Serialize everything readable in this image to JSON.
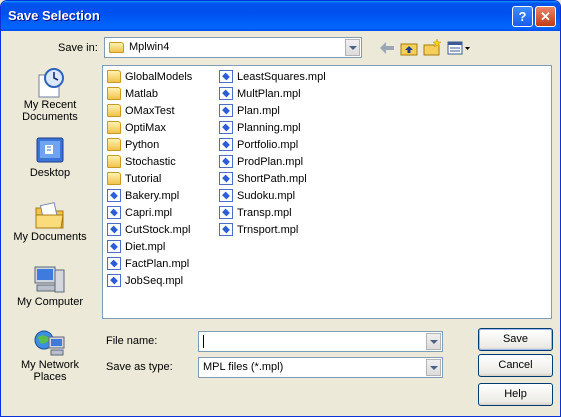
{
  "window": {
    "title": "Save Selection"
  },
  "titlebar": {
    "help": "?",
    "close": "✕"
  },
  "save_in": {
    "label": "Save in:",
    "value": "Mplwin4"
  },
  "places": [
    {
      "label": "My Recent Documents",
      "icon": "clock-documents-icon"
    },
    {
      "label": "Desktop",
      "icon": "desktop-icon"
    },
    {
      "label": "My Documents",
      "icon": "folder-documents-icon"
    },
    {
      "label": "My Computer",
      "icon": "computer-icon"
    },
    {
      "label": "My Network Places",
      "icon": "network-icon"
    }
  ],
  "files_col1": [
    {
      "name": "GlobalModels",
      "type": "folder"
    },
    {
      "name": "Matlab",
      "type": "folder"
    },
    {
      "name": "OMaxTest",
      "type": "folder"
    },
    {
      "name": "OptiMax",
      "type": "folder"
    },
    {
      "name": "Python",
      "type": "folder"
    },
    {
      "name": "Stochastic",
      "type": "folder"
    },
    {
      "name": "Tutorial",
      "type": "folder"
    },
    {
      "name": "Bakery.mpl",
      "type": "file"
    },
    {
      "name": "Capri.mpl",
      "type": "file"
    },
    {
      "name": "CutStock.mpl",
      "type": "file"
    },
    {
      "name": "Diet.mpl",
      "type": "file"
    },
    {
      "name": "FactPlan.mpl",
      "type": "file"
    },
    {
      "name": "JobSeq.mpl",
      "type": "file"
    }
  ],
  "files_col2": [
    {
      "name": "LeastSquares.mpl",
      "type": "file"
    },
    {
      "name": "MultPlan.mpl",
      "type": "file"
    },
    {
      "name": "Plan.mpl",
      "type": "file"
    },
    {
      "name": "Planning.mpl",
      "type": "file"
    },
    {
      "name": "Portfolio.mpl",
      "type": "file"
    },
    {
      "name": "ProdPlan.mpl",
      "type": "file"
    },
    {
      "name": "ShortPath.mpl",
      "type": "file"
    },
    {
      "name": "Sudoku.mpl",
      "type": "file"
    },
    {
      "name": "Transp.mpl",
      "type": "file"
    },
    {
      "name": "Trnsport.mpl",
      "type": "file"
    }
  ],
  "file_name": {
    "label": "File name:",
    "value": ""
  },
  "save_as_type": {
    "label": "Save as type:",
    "value": "MPL files (*.mpl)"
  },
  "buttons": {
    "save": "Save",
    "cancel": "Cancel",
    "help": "Help"
  }
}
